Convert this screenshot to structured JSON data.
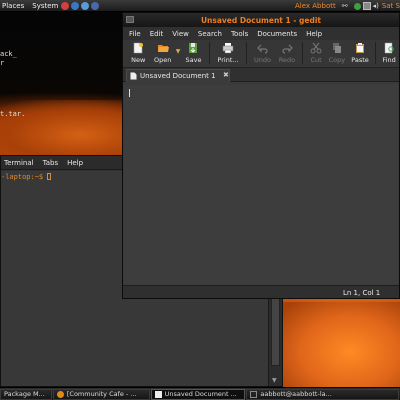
{
  "top_panel": {
    "places": "Places",
    "system": "System",
    "user": "Alex Abbott",
    "clock": "Sat S"
  },
  "desktop": {
    "text_lines": [
      "ack_",
      "r",
      "t.tar."
    ]
  },
  "terminal": {
    "menu": [
      "Terminal",
      "Tabs",
      "Help"
    ],
    "prompt": "-laptop:~$ "
  },
  "gedit": {
    "title": "Unsaved Document 1 - gedit",
    "menu": [
      "File",
      "Edit",
      "View",
      "Search",
      "Tools",
      "Documents",
      "Help"
    ],
    "toolbar": {
      "new": "New",
      "open": "Open",
      "save": "Save",
      "print": "Print...",
      "undo": "Undo",
      "redo": "Redo",
      "cut": "Cut",
      "copy": "Copy",
      "paste": "Paste",
      "find": "Find"
    },
    "tab_label": "Unsaved Document 1",
    "status": "Ln 1, Col 1"
  },
  "taskbar": [
    {
      "label": "Package M...",
      "active": false
    },
    {
      "label": "[Community Cafe - ...",
      "active": false
    },
    {
      "label": "Unsaved Document ...",
      "active": true
    },
    {
      "label": "aabbott@aabbott-la...",
      "active": false
    }
  ],
  "colors": {
    "accent": "#f07d1e",
    "window_bg": "#3a3a3a",
    "panel_bg": "#1c1c1c"
  }
}
